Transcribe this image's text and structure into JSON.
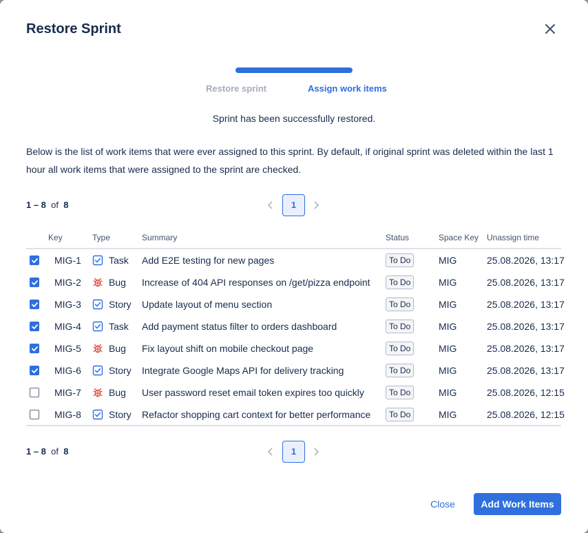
{
  "modal": {
    "title": "Restore Sprint",
    "close_icon": "close-icon"
  },
  "stepper": {
    "steps": [
      {
        "label": "Restore sprint",
        "state": "done"
      },
      {
        "label": "Assign work items",
        "state": "active"
      }
    ],
    "progress_fraction": 1.0,
    "accent_color": "#2f6fde"
  },
  "success_message": "Sprint has been successfully restored.",
  "description": "Below is the list of work items that were ever assigned to this sprint. By default, if original sprint was deleted within the last 1 hour all work items that were assigned to the sprint are checked.",
  "pagination": {
    "range": "1 – 8",
    "of_label": "of",
    "total": "8",
    "current_page": "1"
  },
  "table": {
    "headers": {
      "key": "Key",
      "type": "Type",
      "summary": "Summary",
      "status": "Status",
      "space_key": "Space Key",
      "unassign_time": "Unassign time"
    },
    "rows": [
      {
        "checked": true,
        "key": "MIG-1",
        "type": "Task",
        "type_icon": "task-icon",
        "summary": "Add E2E testing for new pages",
        "status": "To Do",
        "space_key": "MIG",
        "unassign_time": "25.08.2026, 13:17"
      },
      {
        "checked": true,
        "key": "MIG-2",
        "type": "Bug",
        "type_icon": "bug-icon",
        "summary": "Increase of 404 API responses on /get/pizza endpoint",
        "status": "To Do",
        "space_key": "MIG",
        "unassign_time": "25.08.2026, 13:17"
      },
      {
        "checked": true,
        "key": "MIG-3",
        "type": "Story",
        "type_icon": "story-icon",
        "summary": "Update layout of menu section",
        "status": "To Do",
        "space_key": "MIG",
        "unassign_time": "25.08.2026, 13:17"
      },
      {
        "checked": true,
        "key": "MIG-4",
        "type": "Task",
        "type_icon": "task-icon",
        "summary": "Add payment status filter to orders dashboard",
        "status": "To Do",
        "space_key": "MIG",
        "unassign_time": "25.08.2026, 13:17"
      },
      {
        "checked": true,
        "key": "MIG-5",
        "type": "Bug",
        "type_icon": "bug-icon",
        "summary": "Fix layout shift on mobile checkout page",
        "status": "To Do",
        "space_key": "MIG",
        "unassign_time": "25.08.2026, 13:17"
      },
      {
        "checked": true,
        "key": "MIG-6",
        "type": "Story",
        "type_icon": "story-icon",
        "summary": "Integrate Google Maps API for delivery tracking",
        "status": "To Do",
        "space_key": "MIG",
        "unassign_time": "25.08.2026, 13:17"
      },
      {
        "checked": false,
        "key": "MIG-7",
        "type": "Bug",
        "type_icon": "bug-icon",
        "summary": "User password reset email token expires too quickly",
        "status": "To Do",
        "space_key": "MIG",
        "unassign_time": "25.08.2026, 12:15"
      },
      {
        "checked": false,
        "key": "MIG-8",
        "type": "Story",
        "type_icon": "story-icon",
        "summary": "Refactor shopping cart context for better performance",
        "status": "To Do",
        "space_key": "MIG",
        "unassign_time": "25.08.2026, 12:15"
      }
    ]
  },
  "footer": {
    "close_label": "Close",
    "add_label": "Add Work Items"
  },
  "colors": {
    "accent": "#2f6fde",
    "bug": "#e5493a",
    "text": "#172b4d"
  }
}
